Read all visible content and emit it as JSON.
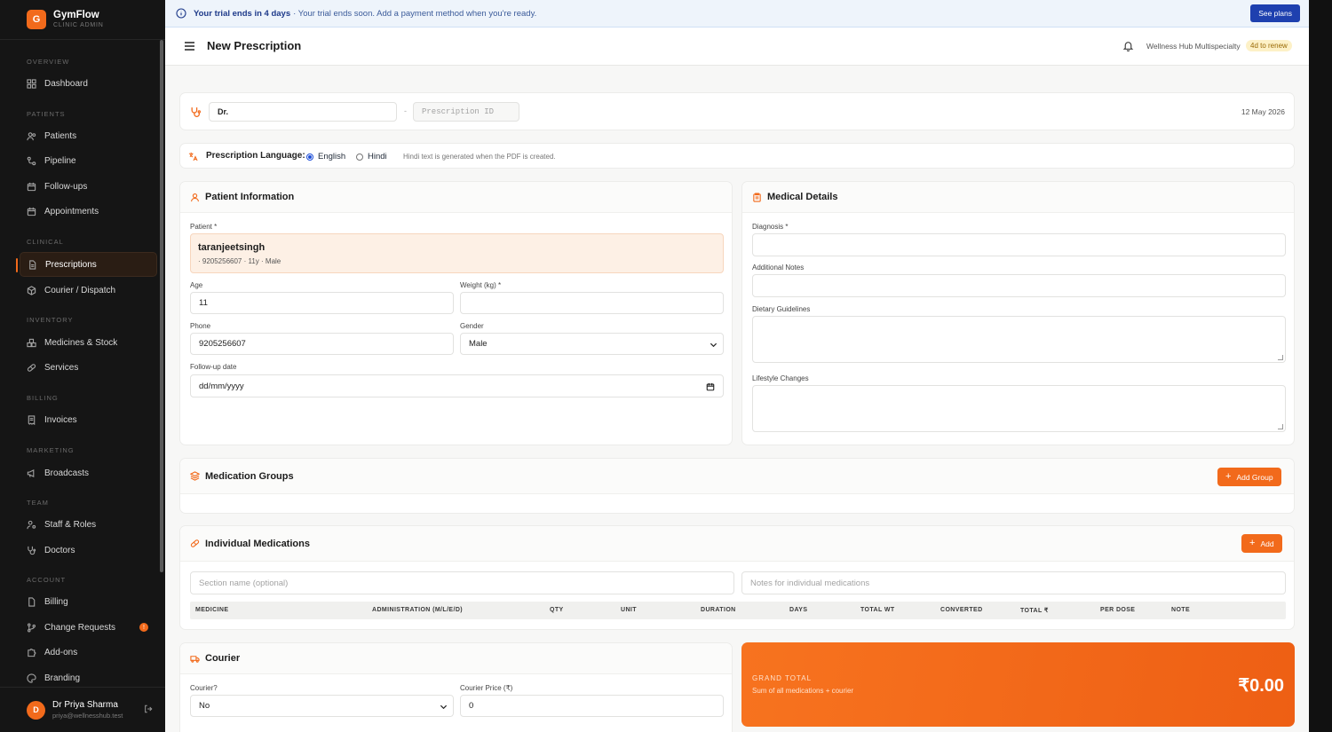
{
  "app": {
    "name": "GymFlow",
    "subtitle": "CLINIC ADMIN",
    "logo_letter": "G"
  },
  "sidebar": {
    "sections": [
      {
        "title": "OVERVIEW",
        "items": [
          {
            "label": "Dashboard",
            "icon": "grid-icon"
          }
        ]
      },
      {
        "title": "PATIENTS",
        "items": [
          {
            "label": "Patients",
            "icon": "users-icon"
          },
          {
            "label": "Pipeline",
            "icon": "pipeline-icon"
          },
          {
            "label": "Follow-ups",
            "icon": "calendar-icon"
          },
          {
            "label": "Appointments",
            "icon": "calendar-icon"
          }
        ]
      },
      {
        "title": "CLINICAL",
        "items": [
          {
            "label": "Prescriptions",
            "icon": "file-icon",
            "active": true
          },
          {
            "label": "Courier / Dispatch",
            "icon": "box-icon"
          }
        ]
      },
      {
        "title": "INVENTORY",
        "items": [
          {
            "label": "Medicines & Stock",
            "icon": "boxes-icon"
          },
          {
            "label": "Services",
            "icon": "pill-icon"
          }
        ]
      },
      {
        "title": "BILLING",
        "items": [
          {
            "label": "Invoices",
            "icon": "receipt-icon"
          }
        ]
      },
      {
        "title": "MARKETING",
        "items": [
          {
            "label": "Broadcasts",
            "icon": "megaphone-icon"
          }
        ]
      },
      {
        "title": "TEAM",
        "items": [
          {
            "label": "Staff & Roles",
            "icon": "user-cog-icon"
          },
          {
            "label": "Doctors",
            "icon": "stethoscope-icon"
          }
        ]
      },
      {
        "title": "ACCOUNT",
        "items": [
          {
            "label": "Billing",
            "icon": "credit-card-icon"
          },
          {
            "label": "Change Requests",
            "icon": "git-branch-icon",
            "badge": "!"
          },
          {
            "label": "Add-ons",
            "icon": "puzzle-icon"
          },
          {
            "label": "Branding",
            "icon": "palette-icon"
          }
        ]
      }
    ],
    "user": {
      "initial": "D",
      "name": "Dr Priya Sharma",
      "email": "priya@wellnesshub.test"
    }
  },
  "trial": {
    "bold": "Your trial ends in 4 days",
    "message": "· Your trial ends soon. Add a payment method when you're ready.",
    "button": "See plans"
  },
  "header": {
    "title": "New Prescription",
    "clinic": "Wellness Hub Multispecialty",
    "renew_badge": "4d to renew"
  },
  "prescription": {
    "doctor_value": "Dr.",
    "separator": "-",
    "id_placeholder": "Prescription ID",
    "date": "12 May 2026"
  },
  "language": {
    "label": "Prescription Language:",
    "options": [
      "English",
      "Hindi"
    ],
    "selected": "English",
    "note": "Hindi text is generated when the PDF is created."
  },
  "patient_info": {
    "title": "Patient Information",
    "patient_label": "Patient *",
    "patient_name": "taranjeetsingh",
    "patient_meta": "· 9205256607 · 11y · Male",
    "age_label": "Age",
    "age_value": "11",
    "weight_label": "Weight (kg) *",
    "weight_value": "",
    "phone_label": "Phone",
    "phone_value": "9205256607",
    "gender_label": "Gender",
    "gender_value": "Male",
    "followup_label": "Follow-up date",
    "followup_value": "dd/mm/yyyy"
  },
  "medical": {
    "title": "Medical Details",
    "diagnosis_label": "Diagnosis *",
    "notes_label": "Additional Notes",
    "dietary_label": "Dietary Guidelines",
    "lifestyle_label": "Lifestyle Changes"
  },
  "groups": {
    "title": "Medication Groups",
    "button": "Add Group"
  },
  "individual": {
    "title": "Individual Medications",
    "button": "Add",
    "section_placeholder": "Section name (optional)",
    "notes_placeholder": "Notes for individual medications",
    "columns": [
      "MEDICINE",
      "ADMINISTRATION (M/L/E/D)",
      "QTY",
      "UNIT",
      "DURATION",
      "DAYS",
      "TOTAL WT",
      "CONVERTED",
      "TOTAL ₹",
      "PER DOSE",
      "NOTE"
    ]
  },
  "courier": {
    "title": "Courier",
    "courier_label": "Courier?",
    "courier_value": "No",
    "price_label": "Courier Price (₹)",
    "price_value": "0"
  },
  "grand_total": {
    "title": "GRAND TOTAL",
    "subtitle": "Sum of all medications + courier",
    "amount": "₹0.00"
  },
  "colors": {
    "accent": "#f26a1b",
    "sidebar_bg": "#151515",
    "trial_bg": "#eef4fb",
    "primary_blue": "#1e40af"
  }
}
